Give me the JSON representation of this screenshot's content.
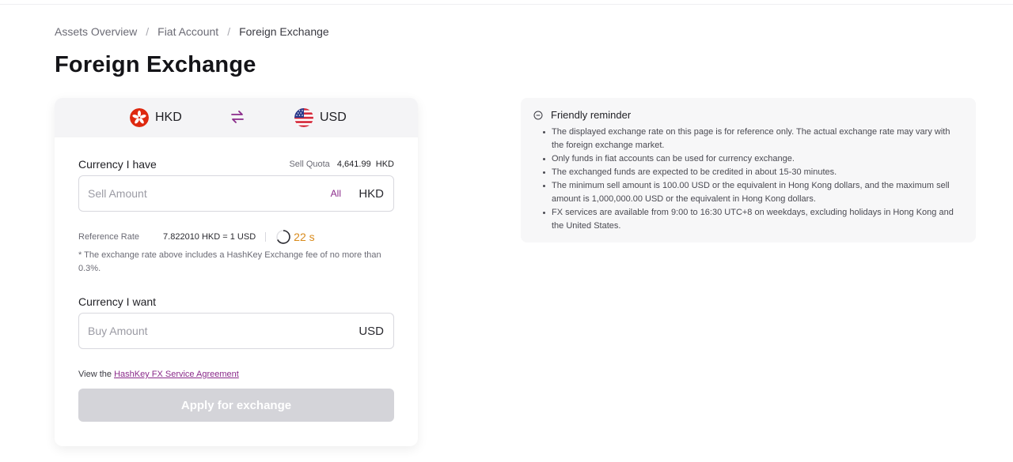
{
  "breadcrumb": {
    "items": [
      "Assets Overview",
      "Fiat Account"
    ],
    "current": "Foreign Exchange",
    "separator": "/"
  },
  "page_title": "Foreign Exchange",
  "exchange": {
    "from_currency": "HKD",
    "to_currency": "USD",
    "from_flag": "hong-kong-flag-icon",
    "to_flag": "us-flag-icon",
    "swap_icon": "swap-arrows-icon",
    "have_label": "Currency I have",
    "sell_quota_label": "Sell Quota",
    "sell_quota_value": "4,641.99",
    "sell_quota_unit": "HKD",
    "sell_placeholder": "Sell Amount",
    "all_label": "All",
    "sell_unit": "HKD",
    "reference_rate_label": "Reference Rate",
    "reference_rate_value": "7.822010  HKD = 1 USD",
    "countdown": "22 s",
    "fee_note": "* The exchange rate above includes a HashKey Exchange fee of no more than 0.3%.",
    "want_label": "Currency I want",
    "buy_placeholder": "Buy Amount",
    "buy_unit": "USD",
    "agreement_prefix": "View the",
    "agreement_link": "HashKey FX Service Agreement",
    "apply_label": "Apply for exchange"
  },
  "reminder": {
    "icon": "info-circle-icon",
    "title": "Friendly reminder",
    "items": [
      "The displayed exchange rate on this page is for reference only. The actual exchange rate may vary with the foreign exchange market.",
      "Only funds in fiat accounts can be used for currency exchange.",
      "The exchanged funds are expected to be credited in about 15-30 minutes.",
      "The minimum sell amount is 100.00 USD or the equivalent in Hong Kong dollars, and the maximum sell amount is 1,000,000.00 USD or the equivalent in Hong Kong dollars.",
      "FX services are available from 9:00 to 16:30 UTC+8 on weekdays, excluding holidays in Hong Kong and the United States."
    ]
  },
  "colors": {
    "accent": "#8a2a8a",
    "timer": "#d98a1a",
    "button_disabled": "#d4d4d9"
  }
}
